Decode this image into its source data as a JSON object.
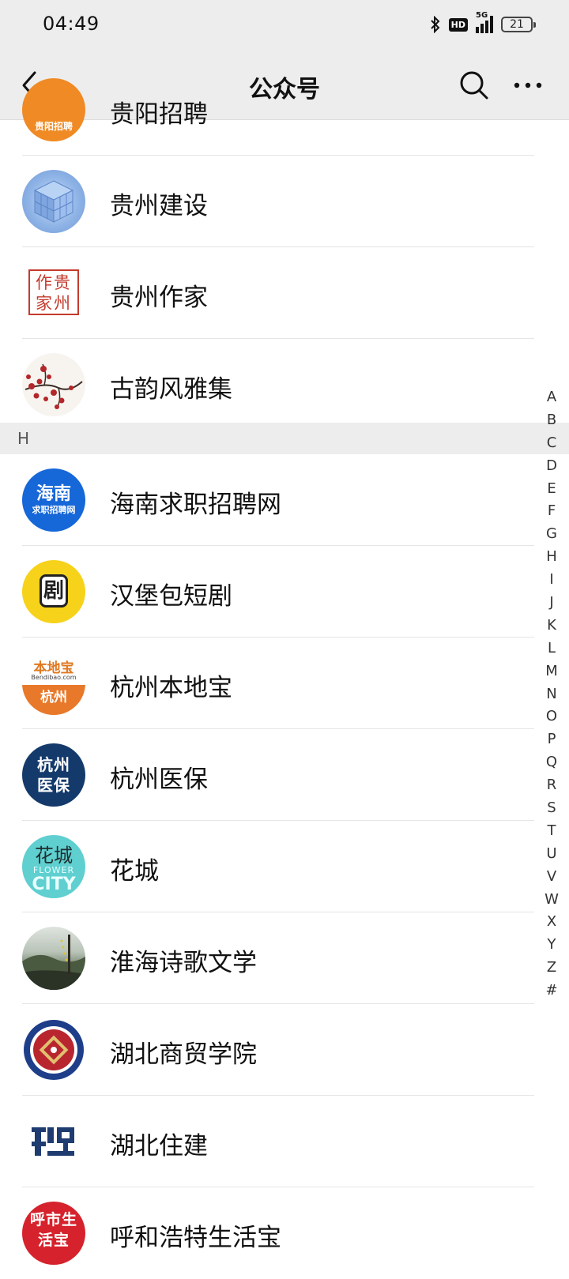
{
  "status_bar": {
    "time": "04:49",
    "network": "5G",
    "hd": "HD",
    "battery": "21"
  },
  "nav": {
    "title": "公众号",
    "back_icon": "chevron-left-icon",
    "search_icon": "search-icon",
    "more_icon": "more-icon"
  },
  "list": {
    "partial_top": {
      "name": "贵阳招聘",
      "logo_text": "贵阳招聘"
    },
    "g_rows": [
      {
        "name": "贵州建设",
        "logo_text": ""
      },
      {
        "name": "贵州作家",
        "logo_text": "作贵家州"
      },
      {
        "name": "古韵风雅集",
        "logo_text": ""
      }
    ],
    "section_h": "H",
    "h_rows": [
      {
        "name": "海南求职招聘网",
        "logo_text": "海南 求职招聘网"
      },
      {
        "name": "汉堡包短剧",
        "logo_text": "剧"
      },
      {
        "name": "杭州本地宝",
        "logo_text": "本地宝 Bendibao.com 杭州"
      },
      {
        "name": "杭州医保",
        "logo_text": "杭州医保"
      },
      {
        "name": "花城",
        "logo_text": "花城 FLOWER CITY"
      },
      {
        "name": "淮海诗歌文学",
        "logo_text": ""
      },
      {
        "name": "湖北商贸学院",
        "logo_text": ""
      },
      {
        "name": "湖北住建",
        "logo_text": ""
      },
      {
        "name": "呼和浩特生活宝",
        "logo_text": "呼市生活宝"
      }
    ]
  },
  "index_letters": [
    "A",
    "B",
    "C",
    "D",
    "E",
    "F",
    "G",
    "H",
    "I",
    "J",
    "K",
    "L",
    "M",
    "N",
    "O",
    "P",
    "Q",
    "R",
    "S",
    "T",
    "U",
    "V",
    "W",
    "X",
    "Y",
    "Z",
    "#"
  ]
}
